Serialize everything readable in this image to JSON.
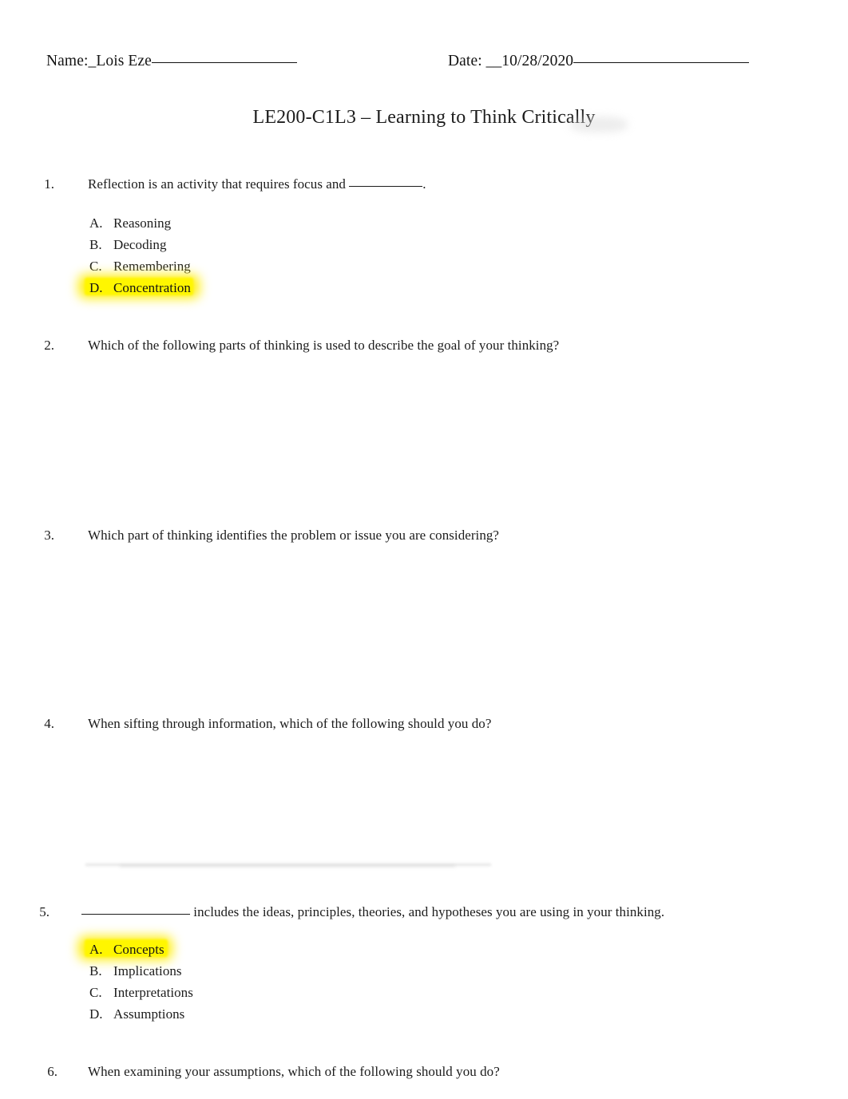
{
  "header": {
    "name_label": "Name:",
    "name_value": "_Lois Eze",
    "date_label": "Date:",
    "date_value": "__10/28/2020"
  },
  "title": "LE200-C1L3 – Learning to Think Critically",
  "questions": [
    {
      "number": "1.",
      "text_before": "Reflection is an activity that requires focus and ",
      "text_after": ".",
      "has_blank": true,
      "options": [
        {
          "letter": "A.",
          "label": "Reasoning",
          "highlighted": false
        },
        {
          "letter": "B.",
          "label": "Decoding",
          "highlighted": false
        },
        {
          "letter": "C.",
          "label": "Remembering",
          "highlighted": false
        },
        {
          "letter": "D.",
          "label": "Concentration",
          "highlighted": true
        }
      ]
    },
    {
      "number": "2.",
      "text_before": "Which of the following parts of thinking is used to describe the goal of your thinking?",
      "text_after": "",
      "has_blank": false,
      "options": []
    },
    {
      "number": "3.",
      "text_before": "Which part of thinking identifies the problem or issue you are considering?",
      "text_after": "",
      "has_blank": false,
      "options": []
    },
    {
      "number": "4.",
      "text_before": "When sifting through information, which of the following should you do?",
      "text_after": "",
      "has_blank": false,
      "options": []
    },
    {
      "number": "5.",
      "text_before": "",
      "text_after": " includes the ideas, principles, theories, and hypotheses you are using in your thinking.",
      "has_blank": true,
      "options": [
        {
          "letter": "A.",
          "label": "Concepts",
          "highlighted": true
        },
        {
          "letter": "B.",
          "label": "Implications",
          "highlighted": false
        },
        {
          "letter": "C.",
          "label": "Interpretations",
          "highlighted": false
        },
        {
          "letter": "D.",
          "label": "Assumptions",
          "highlighted": false
        }
      ]
    },
    {
      "number": "6.",
      "text_before": "When examining your assumptions, which of the following should you do?",
      "text_after": "",
      "has_blank": false,
      "options": []
    }
  ],
  "colors": {
    "highlight_yellow": "#fff600",
    "highlight_glow": "#ffef12",
    "text": "#1c1c1c",
    "page_background": "#ffffff"
  }
}
